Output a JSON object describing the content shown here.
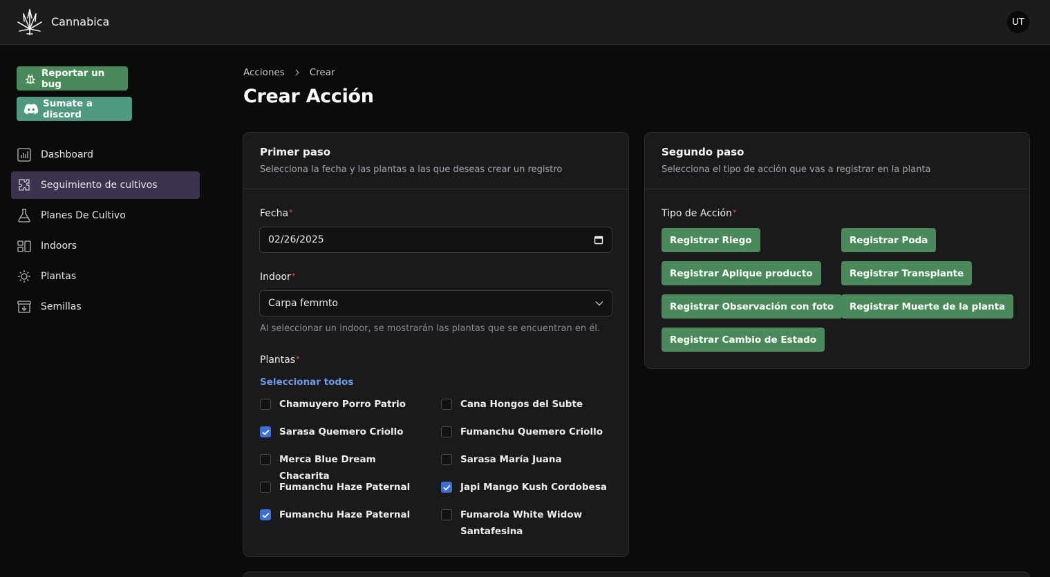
{
  "header": {
    "brand": "Cannabica",
    "avatar_initials": "UT"
  },
  "sidebar": {
    "report_bug_label": "Reportar un bug",
    "discord_label": "Sumate a discord",
    "items": [
      {
        "label": "Dashboard",
        "icon": "chart-icon",
        "active": false
      },
      {
        "label": "Seguimiento de cultivos",
        "icon": "puzzle-icon",
        "active": true
      },
      {
        "label": "Planes De Cultivo",
        "icon": "flask-icon",
        "active": false
      },
      {
        "label": "Indoors",
        "icon": "layout-icon",
        "active": false
      },
      {
        "label": "Plantas",
        "icon": "sun-icon",
        "active": false
      },
      {
        "label": "Semillas",
        "icon": "archive-icon",
        "active": false
      }
    ]
  },
  "breadcrumb": [
    "Acciones",
    "Crear"
  ],
  "page_title": "Crear Acción",
  "step1": {
    "title": "Primer paso",
    "subtitle": "Selecciona la fecha y las plantas a las que deseas crear un registro",
    "fecha_label": "Fecha",
    "fecha_value": "02/26/2025",
    "indoor_label": "Indoor",
    "indoor_value": "Carpa femmto",
    "indoor_helper": "Al seleccionar un indoor, se mostrarán las plantas que se encuentran en él.",
    "plantas_label": "Plantas",
    "select_all_label": "Seleccionar todos",
    "plants": [
      {
        "name": "Chamuyero Porro Patrio",
        "checked": false
      },
      {
        "name": "Cana Hongos del Subte",
        "checked": false
      },
      {
        "name": "Sarasa Quemero Criollo",
        "checked": true
      },
      {
        "name": "Fumanchu Quemero Criollo",
        "checked": false
      },
      {
        "name": "Merca Blue Dream Chacarita",
        "checked": false
      },
      {
        "name": "Sarasa María Juana",
        "checked": false
      },
      {
        "name": "Fumanchu Haze Paternal",
        "checked": false
      },
      {
        "name": "Japi Mango Kush Cordobesa",
        "checked": true
      },
      {
        "name": "Fumanchu Haze Paternal",
        "checked": true
      },
      {
        "name": "Fumarola White Widow Santafesina",
        "checked": false
      }
    ]
  },
  "step2": {
    "title": "Segundo paso",
    "subtitle": "Selecciona el tipo de acción que vas a registrar en la planta",
    "tipo_label": "Tipo de Acción",
    "actions": [
      "Registrar Riego",
      "Registrar Poda",
      "Registrar Aplique producto",
      "Registrar Transplante",
      "Registrar Observación con foto",
      "Registrar Muerte de la planta",
      "Registrar Cambio de Estado"
    ]
  },
  "colors": {
    "accent_green": "#4a8a5a",
    "discord_green": "#4f9a7e",
    "active_nav": "#3d3250",
    "link_blue": "#6e9be8",
    "checkbox_blue": "#3d6fd6",
    "required_red": "#e05252"
  }
}
